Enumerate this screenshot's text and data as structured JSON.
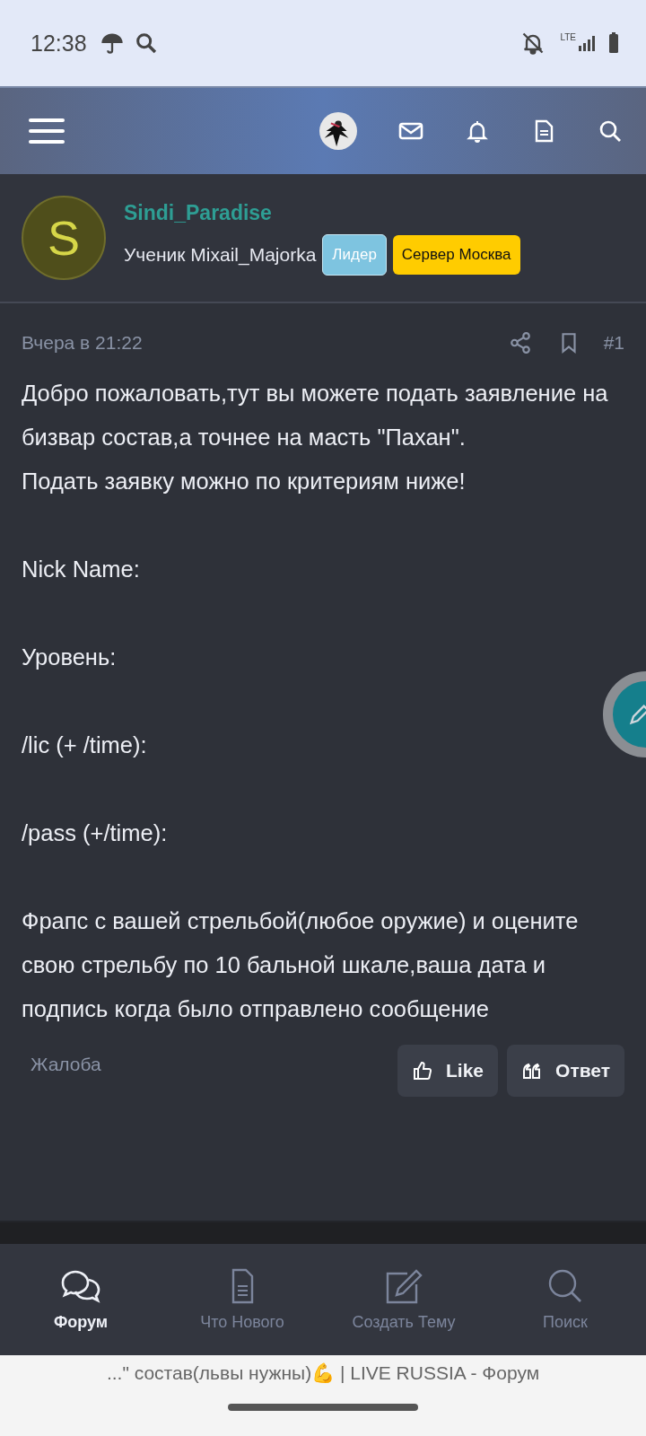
{
  "status_bar": {
    "time": "12:38",
    "network": "LTE"
  },
  "author": {
    "initial": "S",
    "name": "Sindi_Paradise",
    "title": "Ученик Mixail_Majorka",
    "badges": [
      {
        "label": "Лидер",
        "color": "#7ec4e0"
      },
      {
        "label": "Сервер Москва",
        "color": "#ffcc00"
      }
    ]
  },
  "post": {
    "date": "Вчера в 21:22",
    "number": "#1",
    "paragraphs": [
      [
        "Добро пожаловать,тут вы можете подать заявление на бизвар состав,а точнее на масть \"Пахан\".",
        "Подать заявку можно по критериям ниже!"
      ],
      [
        "Nick Name:"
      ],
      [
        "Уровень:"
      ],
      [
        "/lic (+ /time):"
      ],
      [
        "/pass (+/time):"
      ],
      [
        "Фрапс с вашей стрельбой(любое оружие) и оцените свою стрельбу по 10 бальной шкале,ваша дата и подпись когда было отправлено сообщение"
      ]
    ],
    "report": "Жалоба",
    "actions": [
      {
        "kind": "like",
        "label": "Like"
      },
      {
        "kind": "reply",
        "label": "Ответ"
      }
    ]
  },
  "bottom_nav": [
    {
      "kind": "forum",
      "label": "Форум",
      "selected": true
    },
    {
      "kind": "new",
      "label": "Что Нового",
      "selected": false
    },
    {
      "kind": "create",
      "label": "Создать Тему",
      "selected": false
    },
    {
      "kind": "search",
      "label": "Поиск",
      "selected": false
    }
  ],
  "page_title": "...\" состав(львы нужны)💪 | LIVE RUSSIA - Форум"
}
